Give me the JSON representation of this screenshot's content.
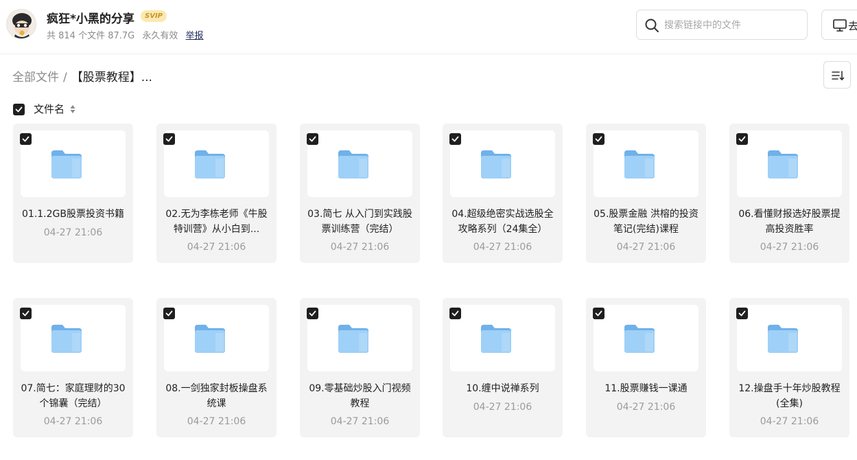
{
  "header": {
    "owner_name": "疯狂*小黑的分享",
    "vip_badge": "SVIP",
    "meta": {
      "file_count": "共 814 个文件 87.7G",
      "validity": "永久有效",
      "report_label": "举报"
    },
    "search": {
      "placeholder": "搜索链接中的文件"
    },
    "save_button_label": "去"
  },
  "breadcrumb": {
    "root": "全部文件",
    "separator": "/",
    "current": "【股票教程】..."
  },
  "list_header": {
    "label": "文件名"
  },
  "files": [
    {
      "name": "01.1.2GB股票投资书籍",
      "date": "04-27 21:06"
    },
    {
      "name": "02.无为李栋老师《牛股特训营》从小白到...",
      "date": "04-27 21:06"
    },
    {
      "name": "03.简七 从入门到实践股票训练营（完结）",
      "date": "04-27 21:06"
    },
    {
      "name": "04.超级绝密实战选股全攻略系列（24集全）",
      "date": "04-27 21:06"
    },
    {
      "name": "05.股票金融 洪榕的投资笔记(完结)课程",
      "date": "04-27 21:06"
    },
    {
      "name": "06.看懂财报选好股票提高投资胜率",
      "date": "04-27 21:06"
    },
    {
      "name": "07.简七：家庭理财的30个锦囊（完结）",
      "date": "04-27 21:06"
    },
    {
      "name": "08.一剑独家封板操盘系统课",
      "date": "04-27 21:06"
    },
    {
      "name": "09.零基础炒股入门视频教程",
      "date": "04-27 21:06"
    },
    {
      "name": "10.缠中说禅系列",
      "date": "04-27 21:06"
    },
    {
      "name": "11.股票赚钱一课通",
      "date": "04-27 21:06"
    },
    {
      "name": "12.操盘手十年炒股教程(全集)",
      "date": "04-27 21:06"
    }
  ],
  "colors": {
    "folder": "#8cc6f4",
    "checkbox": "#1f1f1f",
    "card_bg": "#f3f3f3"
  }
}
